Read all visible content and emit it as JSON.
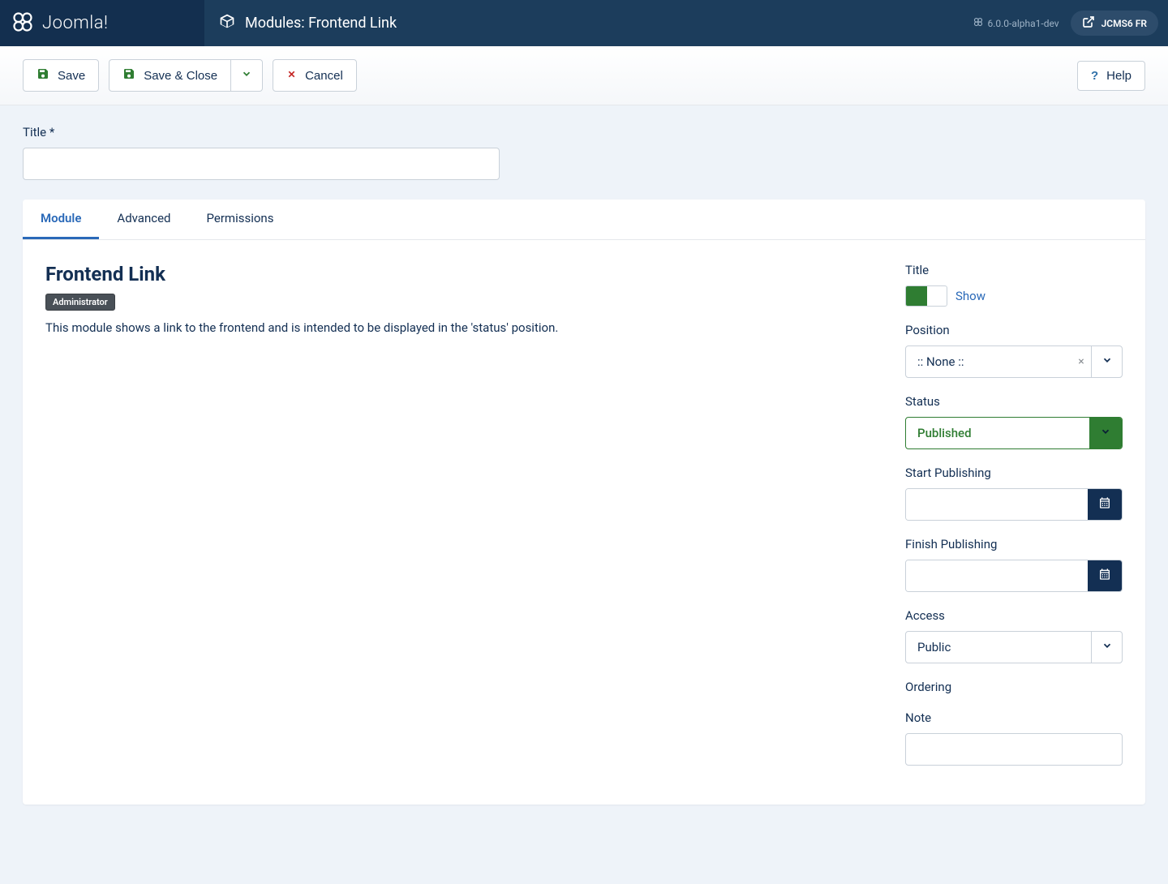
{
  "header": {
    "brand": "Joomla!",
    "page_title": "Modules: Frontend Link",
    "version": "6.0.0-alpha1-dev",
    "site_name": "JCMS6 FR"
  },
  "toolbar": {
    "save": "Save",
    "save_close": "Save & Close",
    "cancel": "Cancel",
    "help": "Help"
  },
  "form": {
    "title_label": "Title *",
    "title_value": ""
  },
  "tabs": [
    {
      "label": "Module",
      "active": true
    },
    {
      "label": "Advanced",
      "active": false
    },
    {
      "label": "Permissions",
      "active": false
    }
  ],
  "module": {
    "heading": "Frontend Link",
    "badge": "Administrator",
    "description": "This module shows a link to the frontend and is intended to be displayed in the 'status' position."
  },
  "sidebar": {
    "title_label": "Title",
    "title_toggle_text": "Show",
    "position_label": "Position",
    "position_value": ":: None ::",
    "status_label": "Status",
    "status_value": "Published",
    "start_label": "Start Publishing",
    "start_value": "",
    "finish_label": "Finish Publishing",
    "finish_value": "",
    "access_label": "Access",
    "access_value": "Public",
    "ordering_label": "Ordering",
    "note_label": "Note",
    "note_value": ""
  }
}
